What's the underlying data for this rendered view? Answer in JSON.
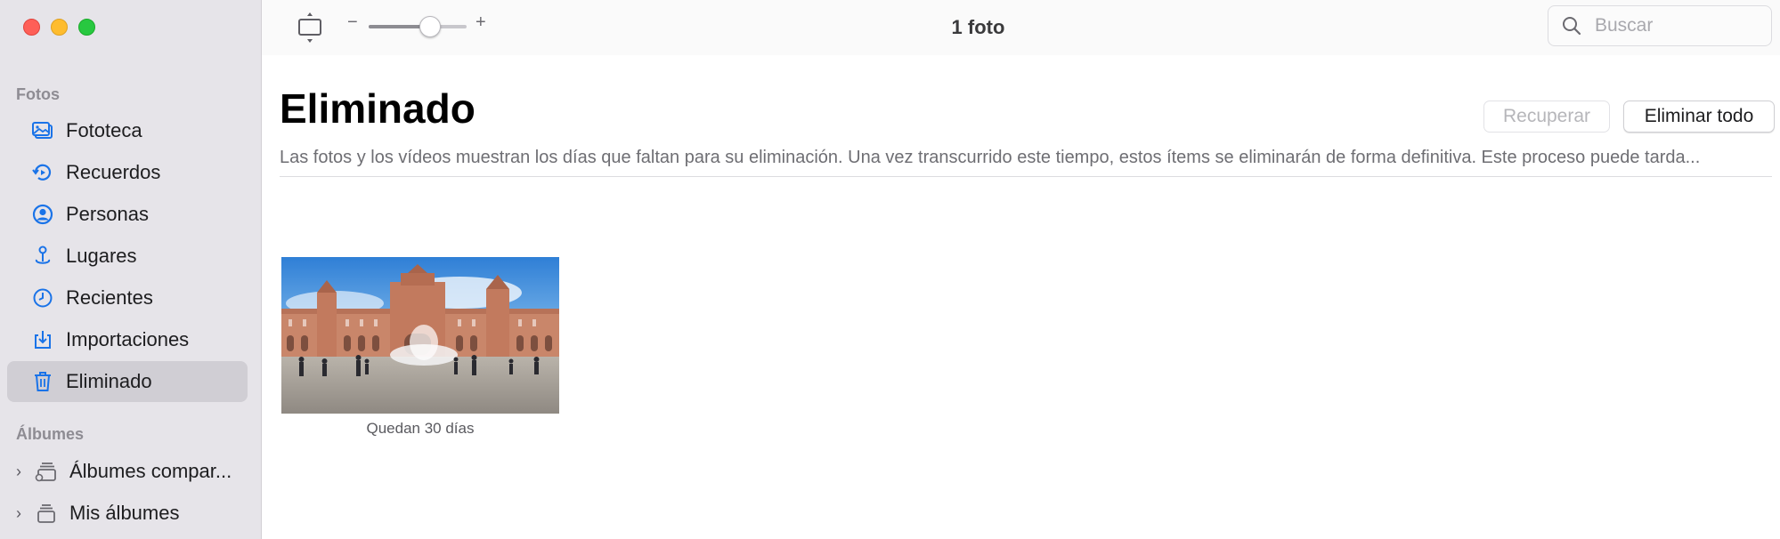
{
  "sidebar": {
    "section_fotos": "Fotos",
    "items": [
      {
        "label": "Fototeca",
        "icon": "photo-library-icon"
      },
      {
        "label": "Recuerdos",
        "icon": "memories-icon"
      },
      {
        "label": "Personas",
        "icon": "person-icon"
      },
      {
        "label": "Lugares",
        "icon": "map-pin-icon"
      },
      {
        "label": "Recientes",
        "icon": "clock-icon"
      },
      {
        "label": "Importaciones",
        "icon": "import-icon"
      },
      {
        "label": "Eliminado",
        "icon": "trash-icon",
        "selected": true
      }
    ],
    "section_albumes": "Álbumes",
    "albums": [
      {
        "label": "Álbumes compar...",
        "icon": "shared-albums-icon"
      },
      {
        "label": "Mis álbumes",
        "icon": "albums-stack-icon"
      }
    ]
  },
  "toolbar": {
    "title": "1 foto",
    "zoom_minus": "−",
    "zoom_plus": "+",
    "zoom_level": 0.62,
    "search_placeholder": "Buscar"
  },
  "main": {
    "title": "Eliminado",
    "recover_label": "Recuperar",
    "delete_all_label": "Eliminar todo",
    "description": "Las fotos y los vídeos muestran los días que faltan para su eliminación. Una vez transcurrido este tiempo, estos ítems se eliminarán de forma definitiva. Este proceso puede tarda...",
    "photos": [
      {
        "caption": "Quedan 30 días"
      }
    ]
  },
  "colors": {
    "accent": "#1a73e8",
    "sidebar_bg": "#e6e4e9",
    "selected_bg": "#d0ced4"
  }
}
